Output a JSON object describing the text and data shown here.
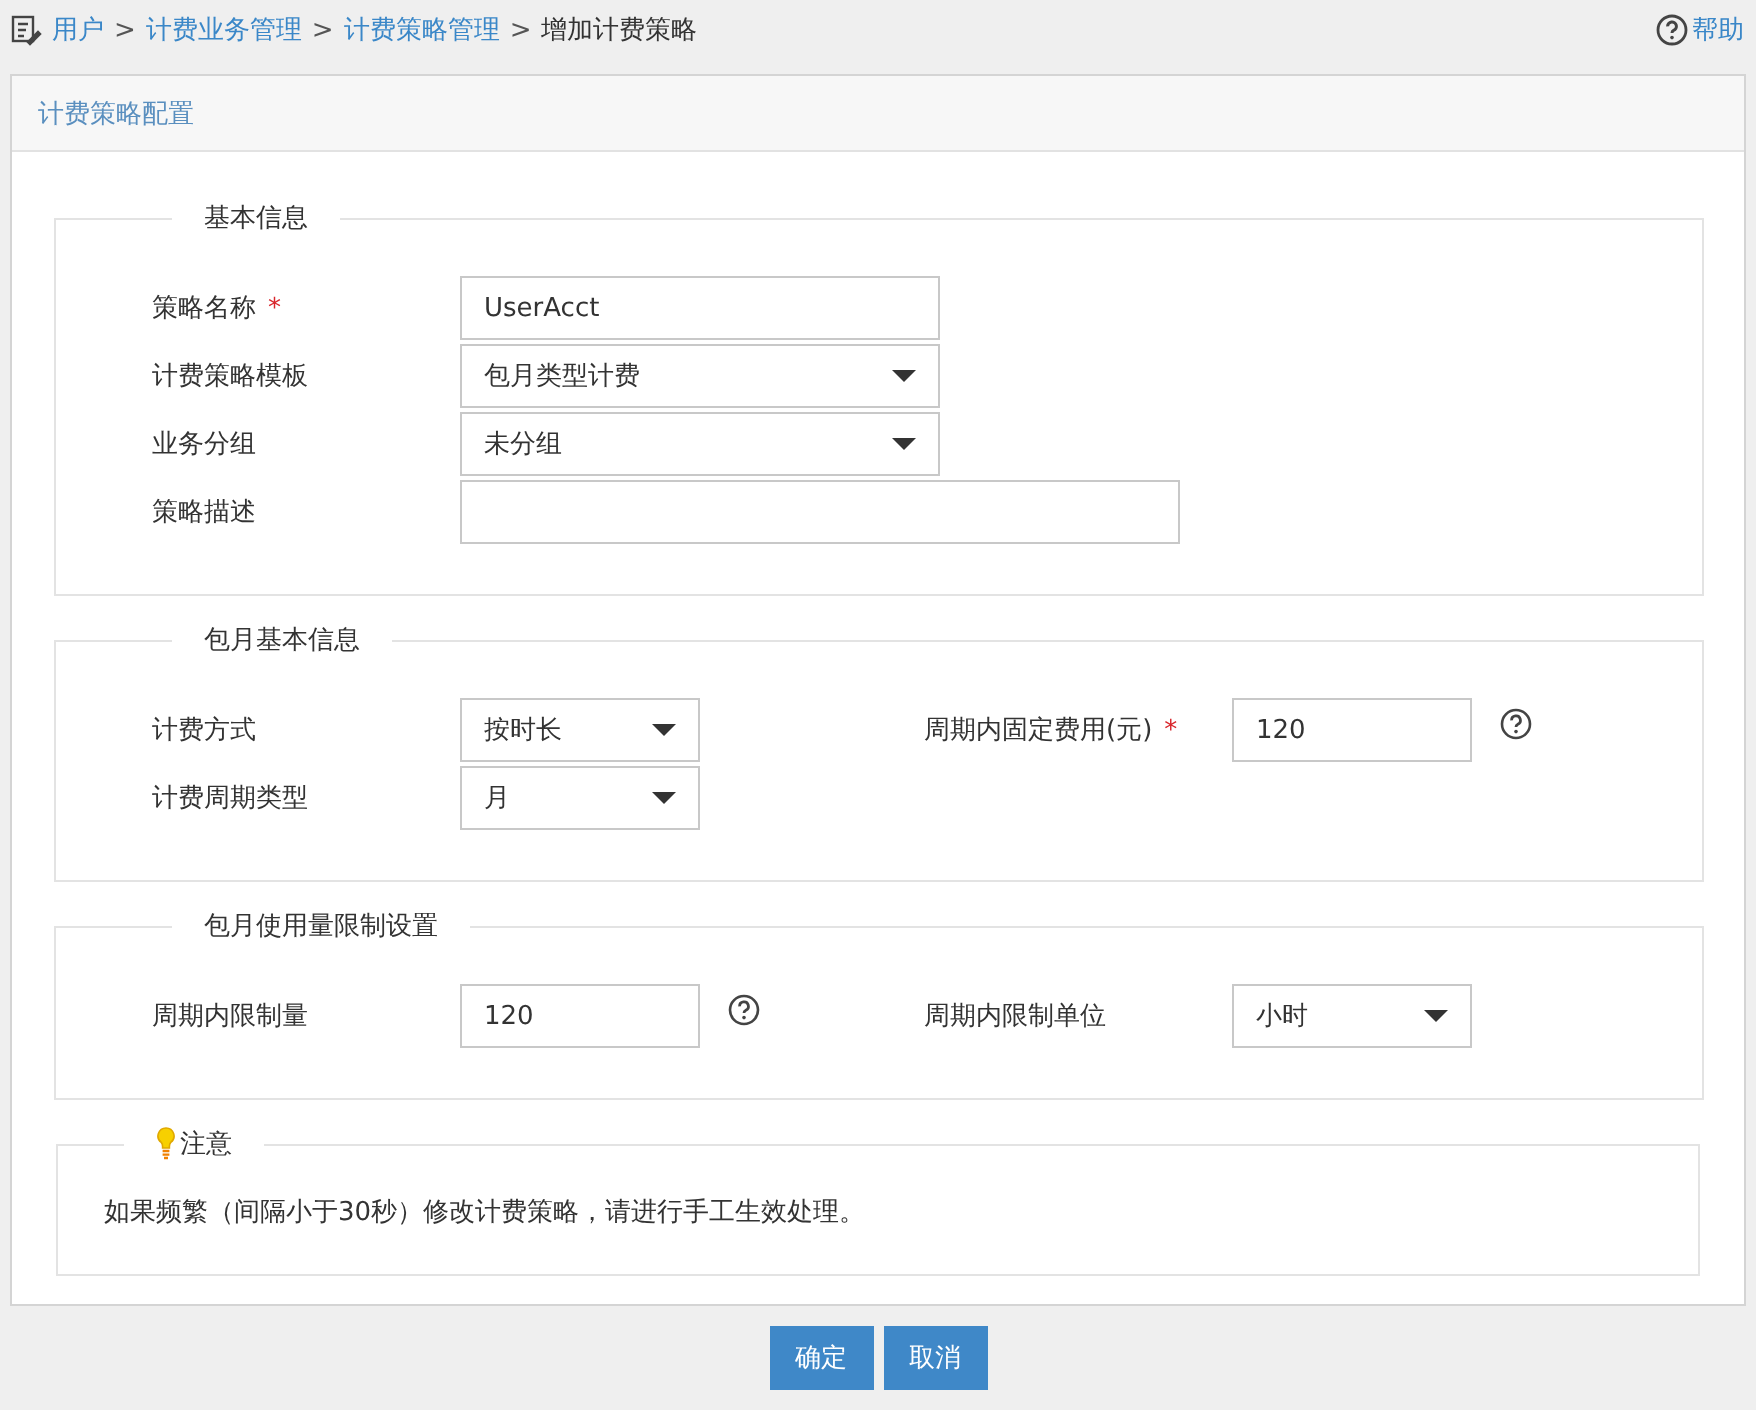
{
  "breadcrumb": {
    "separator": ">",
    "items": [
      {
        "text": "用户",
        "link": true
      },
      {
        "text": "计费业务管理",
        "link": true
      },
      {
        "text": "计费策略管理",
        "link": true
      },
      {
        "text": "增加计费策略",
        "link": false
      }
    ]
  },
  "help": {
    "label": "帮助"
  },
  "panel": {
    "title": "计费策略配置"
  },
  "sections": [
    {
      "legend": "基本信息",
      "rows": [
        {
          "fields": [
            {
              "label": "策略名称",
              "required_mark": "*",
              "kind": "text",
              "value": "UserAcct"
            }
          ]
        },
        {
          "fields": [
            {
              "label": "计费策略模板",
              "kind": "select",
              "value": "包月类型计费"
            }
          ]
        },
        {
          "fields": [
            {
              "label": "业务分组",
              "kind": "select",
              "value": "未分组"
            }
          ]
        },
        {
          "fields": [
            {
              "label": "策略描述",
              "kind": "memo"
            }
          ]
        }
      ]
    },
    {
      "legend": "包月基本信息",
      "rows": [
        {
          "fields": [
            {
              "label": "计费方式",
              "kind": "select",
              "value": "按时长"
            },
            {
              "label": "周期内固定费用(元)",
              "required_mark": "*",
              "kind": "text",
              "value": "120",
              "help": true
            }
          ]
        },
        {
          "fields": [
            {
              "label": "计费周期类型",
              "kind": "select",
              "value": "月"
            }
          ]
        }
      ]
    },
    {
      "legend": "包月使用量限制设置",
      "rows": [
        {
          "fields": [
            {
              "label": "周期内限制量",
              "kind": "text",
              "value": "120",
              "help": true
            },
            {
              "label": "周期内限制单位",
              "kind": "select",
              "value": "小时"
            }
          ]
        }
      ]
    }
  ],
  "notice": {
    "title": "注意",
    "text": "如果频繁（间隔小于30秒）修改计费策略，请进行手工生效处理。"
  },
  "buttons": [
    {
      "label": "确定"
    },
    {
      "label": "取消"
    }
  ]
}
